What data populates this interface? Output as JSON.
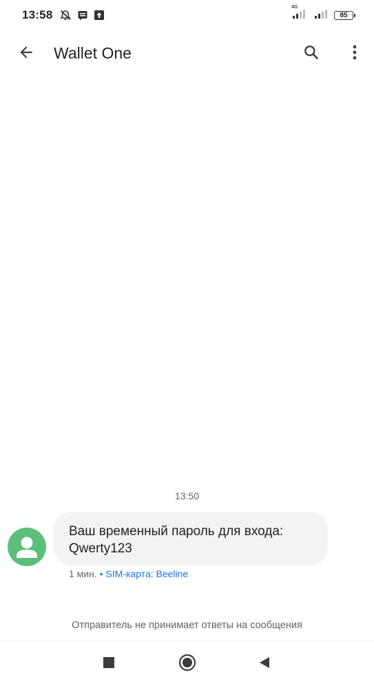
{
  "status_bar": {
    "time": "13:58",
    "network_type": "4G",
    "battery_level": "85"
  },
  "app_bar": {
    "title": "Wallet One",
    "icons": [
      "back-arrow-icon",
      "search-icon",
      "more-vert-icon"
    ]
  },
  "conversation": {
    "timestamp": "13:50",
    "message": {
      "text": "Ваш временный пароль для входа: Qwerty123",
      "age": "1 мин.",
      "separator": "•",
      "sim": "SIM-карта: Beeline"
    },
    "no_reply_notice": "Отправитель не принимает ответы на сообщения"
  },
  "colors": {
    "avatar": "#5bbf7a",
    "bubble": "#f1f3f4",
    "sim_link": "#1a73e8"
  },
  "nav_bar": {
    "icons": [
      "recents-square-icon",
      "home-circle-icon",
      "back-triangle-icon"
    ]
  }
}
